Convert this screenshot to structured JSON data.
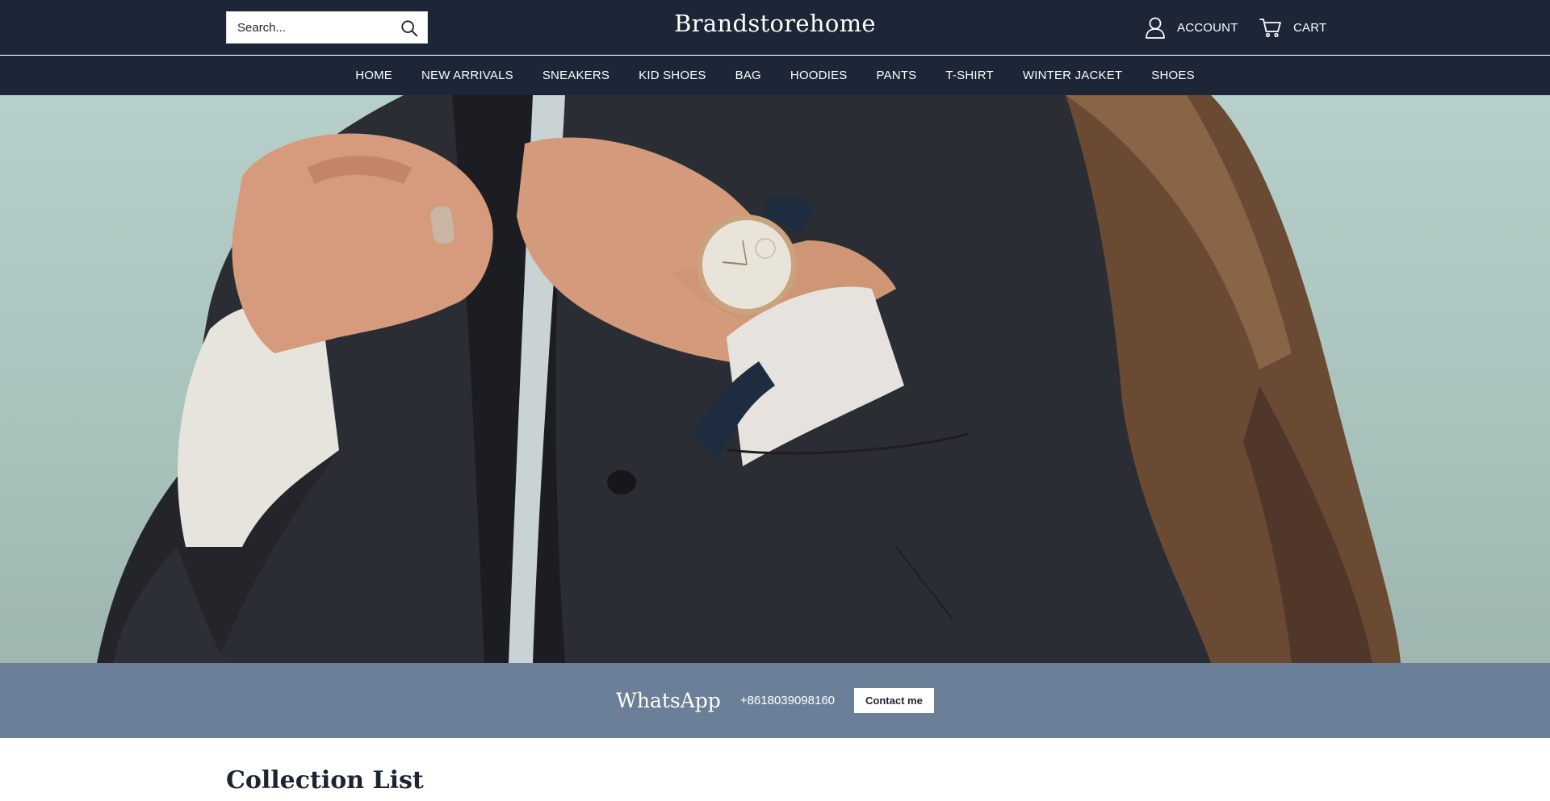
{
  "header": {
    "search_placeholder": "Search...",
    "brand": "Brandstorehome",
    "account_label": "ACCOUNT",
    "cart_label": "CART"
  },
  "nav": {
    "items": [
      "HOME",
      "NEW ARRIVALS",
      "SNEAKERS",
      "KID SHOES",
      "BAG",
      "HOODIES",
      "PANTS",
      "T-SHIRT",
      "WINTER JACKET",
      "SHOES"
    ]
  },
  "hero": {
    "image": "man-in-dark-jacket-with-watch"
  },
  "contact": {
    "title": "WhatsApp",
    "phone": "+8618039098160",
    "button_label": "Contact me"
  },
  "collection": {
    "title": "Collection List"
  },
  "colors": {
    "header_bg": "#1c2636",
    "contact_bg": "#6b8098",
    "text_light": "#ffffff",
    "text_dark": "#1c2431"
  },
  "icons": {
    "search": "search-icon",
    "account": "user-icon",
    "cart": "cart-icon"
  }
}
